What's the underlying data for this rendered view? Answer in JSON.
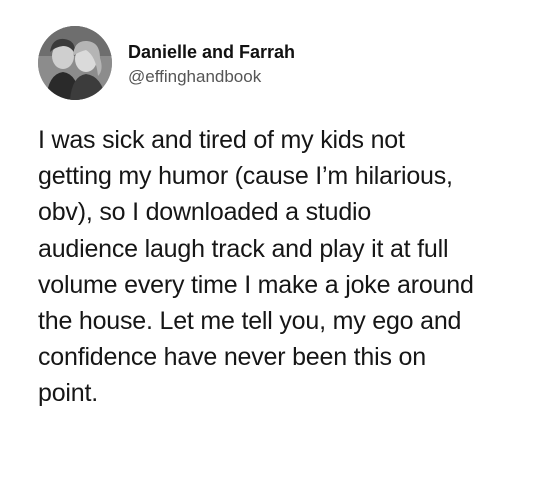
{
  "author": {
    "display_name": "Danielle and Farrah",
    "handle": "@effinghandbook",
    "avatar_icon": "profile-photo-icon"
  },
  "tweet": {
    "lines": [
      "I was sick and tired of my kids not",
      "getting my humor (cause I’m hilarious,",
      "obv), so I downloaded a studio",
      "audience laugh track and play it at full",
      "volume every time I make a joke around",
      "the house. Let me tell you, my ego and",
      "confidence have never been this on",
      "point."
    ]
  }
}
